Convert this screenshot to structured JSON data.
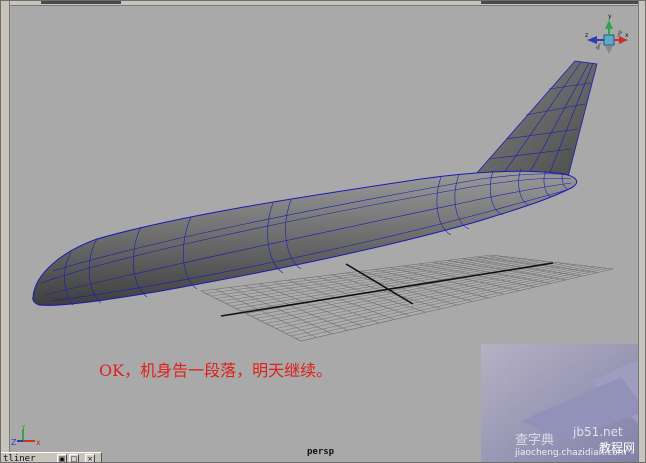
{
  "viewport": {
    "camera": "persp",
    "caption": "OK，机身告一段落，明天继续。",
    "axis_labels": {
      "x": "x",
      "y": "Y",
      "z": "Z"
    },
    "viewcube_axis_labels": {
      "x": "x",
      "y": "y",
      "z": "z"
    }
  },
  "panel": {
    "outliner_title": "tliner",
    "buttons": [
      "▣",
      "□",
      "×"
    ]
  },
  "watermark": {
    "line1": "查字典",
    "line2": "jb51.net",
    "line3": "教程网",
    "line4": "jiaocheng.chazidian.com"
  },
  "colors": {
    "background": "#a9a9a9",
    "wireframe": "#1a1ab4",
    "model": "#5a5a5a",
    "grid": "#6f6f6f",
    "caption": "#e0201a"
  },
  "icons": [
    "viewcube-icon",
    "axis-triad-icon"
  ]
}
